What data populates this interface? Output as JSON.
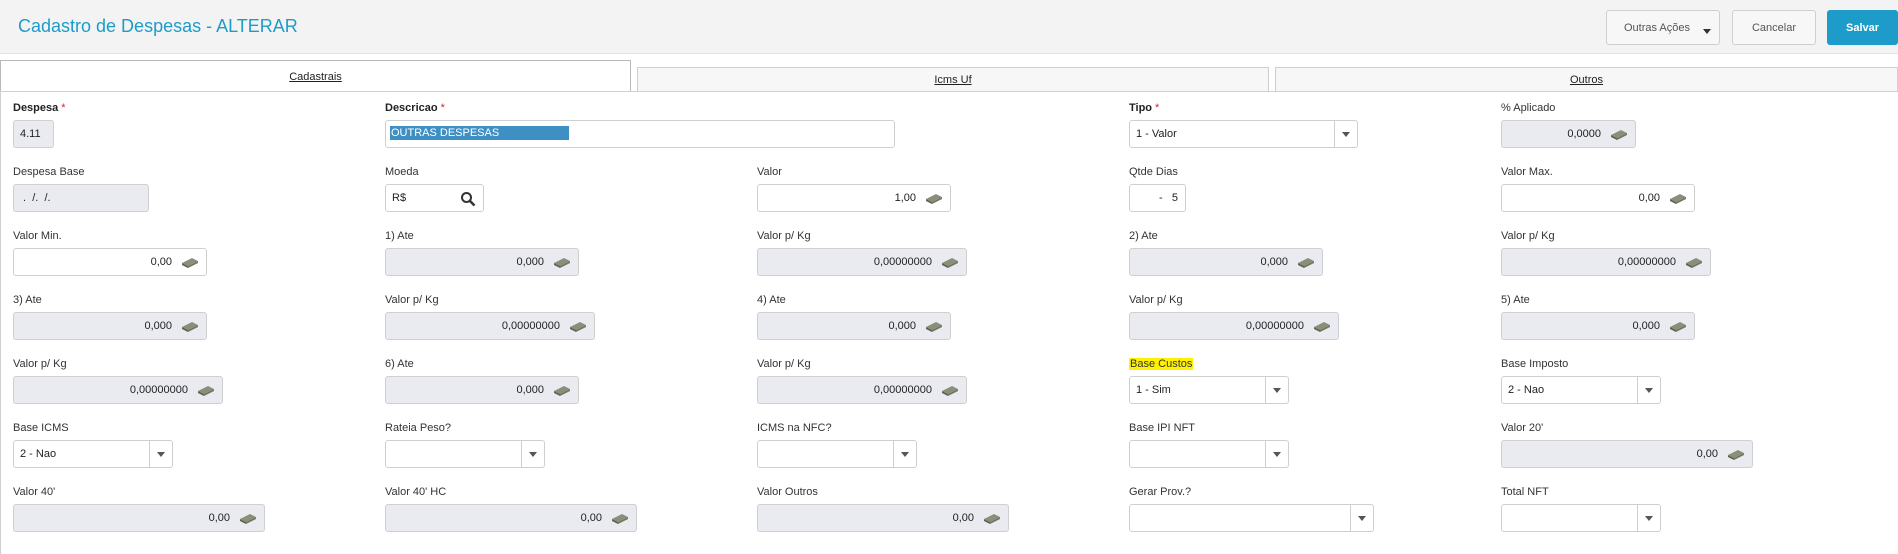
{
  "header": {
    "title": "Cadastro de Despesas - ALTERAR",
    "outras_acoes": "Outras Ações",
    "cancelar": "Cancelar",
    "salvar": "Salvar"
  },
  "tabs": [
    "Cadastrais",
    "Icms Uf",
    "Outros"
  ],
  "form": {
    "despesa": {
      "label": "Despesa",
      "value": "4.11"
    },
    "descricao": {
      "label": "Descricao",
      "value": "OUTRAS DESPESAS"
    },
    "tipo": {
      "label": "Tipo",
      "value": "1 - Valor"
    },
    "pct_aplicado": {
      "label": "% Aplicado",
      "value": "0,0000"
    },
    "despesa_base": {
      "label": "Despesa Base",
      "value": " .  /.  /."
    },
    "moeda": {
      "label": "Moeda",
      "value": "R$"
    },
    "valor": {
      "label": "Valor",
      "value": "1,00"
    },
    "qtde_dias": {
      "label": "Qtde Dias",
      "value": "-   5"
    },
    "valor_max": {
      "label": "Valor Max.",
      "value": "0,00"
    },
    "valor_min": {
      "label": "Valor Min.",
      "value": "0,00"
    },
    "ate1": {
      "label": "1) Ate",
      "value": "0,000"
    },
    "vkg1": {
      "label": "Valor p/ Kg",
      "value": "0,00000000"
    },
    "ate2": {
      "label": "2) Ate",
      "value": "0,000"
    },
    "vkg2": {
      "label": "Valor p/ Kg",
      "value": "0,00000000"
    },
    "ate3": {
      "label": "3) Ate",
      "value": "0,000"
    },
    "vkg3": {
      "label": "Valor p/ Kg",
      "value": "0,00000000"
    },
    "ate4": {
      "label": "4) Ate",
      "value": "0,000"
    },
    "vkg4": {
      "label": "Valor p/ Kg",
      "value": "0,00000000"
    },
    "ate5": {
      "label": "5) Ate",
      "value": "0,000"
    },
    "vkg5": {
      "label": "Valor p/ Kg",
      "value": "0,00000000"
    },
    "ate6": {
      "label": "6) Ate",
      "value": "0,000"
    },
    "vkg6": {
      "label": "Valor p/ Kg",
      "value": "0,00000000"
    },
    "base_custos": {
      "label": "Base Custos",
      "value": "1 - Sim"
    },
    "base_imposto": {
      "label": "Base Imposto",
      "value": "2 - Nao"
    },
    "base_icms": {
      "label": "Base ICMS",
      "value": "2 - Nao"
    },
    "rateia_peso": {
      "label": "Rateia Peso?",
      "value": ""
    },
    "icms_nfc": {
      "label": "ICMS na NFC?",
      "value": ""
    },
    "base_ipi": {
      "label": "Base IPI NFT",
      "value": ""
    },
    "valor20": {
      "label": "Valor 20'",
      "value": "0,00"
    },
    "valor40": {
      "label": "Valor 40'",
      "value": "0,00"
    },
    "valor40hc": {
      "label": "Valor 40' HC",
      "value": "0,00"
    },
    "valor_outros": {
      "label": "Valor Outros",
      "value": "0,00"
    },
    "gerar_prov": {
      "label": "Gerar Prov.?",
      "value": ""
    },
    "total_nft": {
      "label": "Total NFT",
      "value": ""
    }
  },
  "icons": {
    "calc": "calculator-icon",
    "search": "search-icon",
    "dropdown": "chevron-down-icon"
  },
  "colors": {
    "accent": "#1d9cc9",
    "readonly_bg": "#e9ebf0",
    "highlight": "#fff200",
    "selection": "#3d8fc4"
  }
}
